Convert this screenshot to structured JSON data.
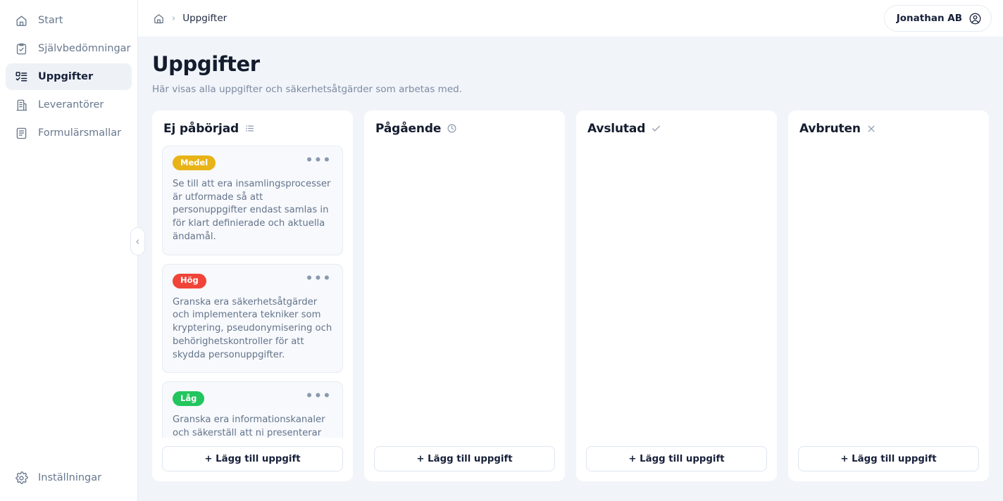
{
  "sidebar": {
    "items": [
      {
        "label": "Start",
        "icon": "home-icon",
        "active": false
      },
      {
        "label": "Självbedömningar",
        "icon": "clipboard-check-icon",
        "active": false
      },
      {
        "label": "Uppgifter",
        "icon": "task-list-icon",
        "active": true
      },
      {
        "label": "Leverantörer",
        "icon": "building-icon",
        "active": false
      },
      {
        "label": "Formulärsmallar",
        "icon": "form-template-icon",
        "active": false
      }
    ],
    "bottom": {
      "label": "Inställningar",
      "icon": "gear-icon"
    },
    "collapse_handle": {
      "name": "collapse-sidebar-toggle",
      "icon": "chevron-left-icon"
    }
  },
  "topbar": {
    "breadcrumb": {
      "home_icon": "home-icon",
      "separator": "›",
      "current": "Uppgifter"
    },
    "user": {
      "name": "Jonathan AB",
      "icon": "user-circle-icon"
    }
  },
  "page": {
    "title": "Uppgifter",
    "subtitle": "Här visas alla uppgifter och säkerhetsåtgärder som arbetas med."
  },
  "colors": {
    "priority_medel": "#e8b317",
    "priority_hog": "#f04438",
    "priority_lag": "#22c55e",
    "board_bg": "#f1f4f9",
    "card_bg": "#f7f9fc"
  },
  "board": {
    "add_task_label": "+ Lägg till uppgift",
    "card_menu_label": "•••",
    "columns": [
      {
        "title": "Ej påbörjad",
        "icon": "list-icon",
        "tasks": [
          {
            "priority": "Medel",
            "priority_class": "badge-medel",
            "text": "Se till att era insamlingsprocesser är utformade så att personuppgifter endast samlas in för klart definierade och aktuella ändamål."
          },
          {
            "priority": "Hög",
            "priority_class": "badge-hog",
            "text": "Granska era säkerhetsåtgärder och implementera tekniker som kryptering, pseudonymisering och behörighetskontroller för att skydda personuppgifter."
          },
          {
            "priority": "Låg",
            "priority_class": "badge-lag",
            "text": "Granska era informationskanaler och säkerställ att ni presenterar"
          }
        ]
      },
      {
        "title": "Pågående",
        "icon": "clock-icon",
        "tasks": []
      },
      {
        "title": "Avslutad",
        "icon": "check-icon",
        "tasks": []
      },
      {
        "title": "Avbruten",
        "icon": "close-icon",
        "tasks": []
      }
    ]
  }
}
